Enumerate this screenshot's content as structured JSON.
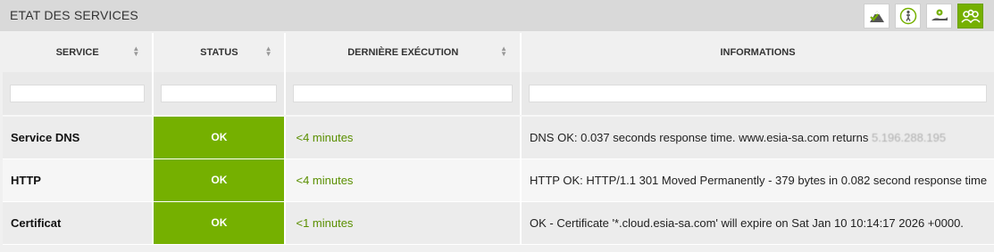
{
  "header": {
    "title": "ETAT DES SERVICES",
    "tools": [
      {
        "icon": "mountain-check-icon",
        "active": false
      },
      {
        "icon": "person-icon",
        "active": false
      },
      {
        "icon": "hand-gear-icon",
        "active": false
      },
      {
        "icon": "group-icon",
        "active": true
      }
    ]
  },
  "table": {
    "columns": [
      "SERVICE",
      "STATUS",
      "DERNIÈRE EXÉCUTION",
      "INFORMATIONS"
    ],
    "rows": [
      {
        "service": "Service DNS",
        "status": "OK",
        "last_run": "<4 minutes",
        "info": "DNS OK: 0.037 seconds response time. www.esia-sa.com returns ",
        "info_masked": "5.196.288.195"
      },
      {
        "service": "HTTP",
        "status": "OK",
        "last_run": "<4 minutes",
        "info": "HTTP OK: HTTP/1.1 301 Moved Permanently - 379 bytes in 0.082 second response time"
      },
      {
        "service": "Certificat",
        "status": "OK",
        "last_run": "<1 minutes",
        "info": "OK - Certificate '*.cloud.esia-sa.com' will expire on Sat Jan 10 10:14:17 2026 +0000."
      }
    ]
  },
  "colors": {
    "status_ok": "#75b000",
    "exec_text": "#5a8f00",
    "header_bg": "#d9d9d9"
  }
}
